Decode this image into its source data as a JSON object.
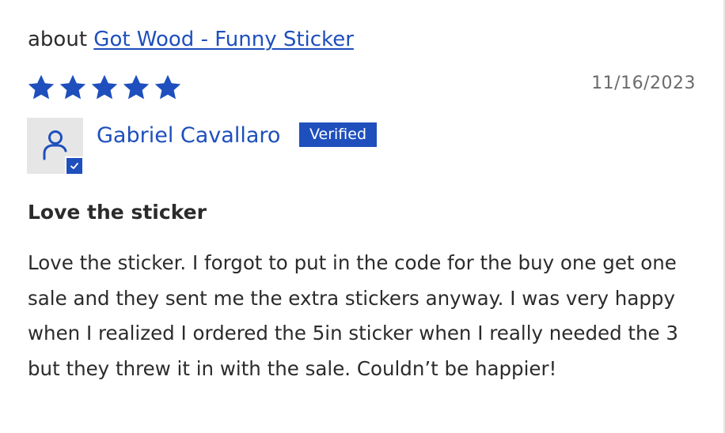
{
  "product": {
    "about_prefix": "about",
    "link_text": "Got Wood - Funny Sticker"
  },
  "rating": {
    "stars": 5,
    "max_stars": 5,
    "color": "#1e4fbd"
  },
  "date": "11/16/2023",
  "reviewer": {
    "name": "Gabriel Cavallaro",
    "badge": "Verified",
    "avatar_icon": "user-icon",
    "check_icon": "checkmark-icon"
  },
  "review": {
    "title": "Love the sticker",
    "body": "Love the sticker. I forgot to put in the code for the buy one get one sale and they sent me the extra stickers anyway. I was very happy when I realized I ordered the 5in sticker when I really needed the 3 but they threw it in with the sale. Couldn’t be happier!"
  },
  "colors": {
    "accent": "#1e4fbd",
    "text": "#2b2b2b",
    "muted": "#6b6b6b",
    "avatar_bg": "#e6e6e6"
  }
}
